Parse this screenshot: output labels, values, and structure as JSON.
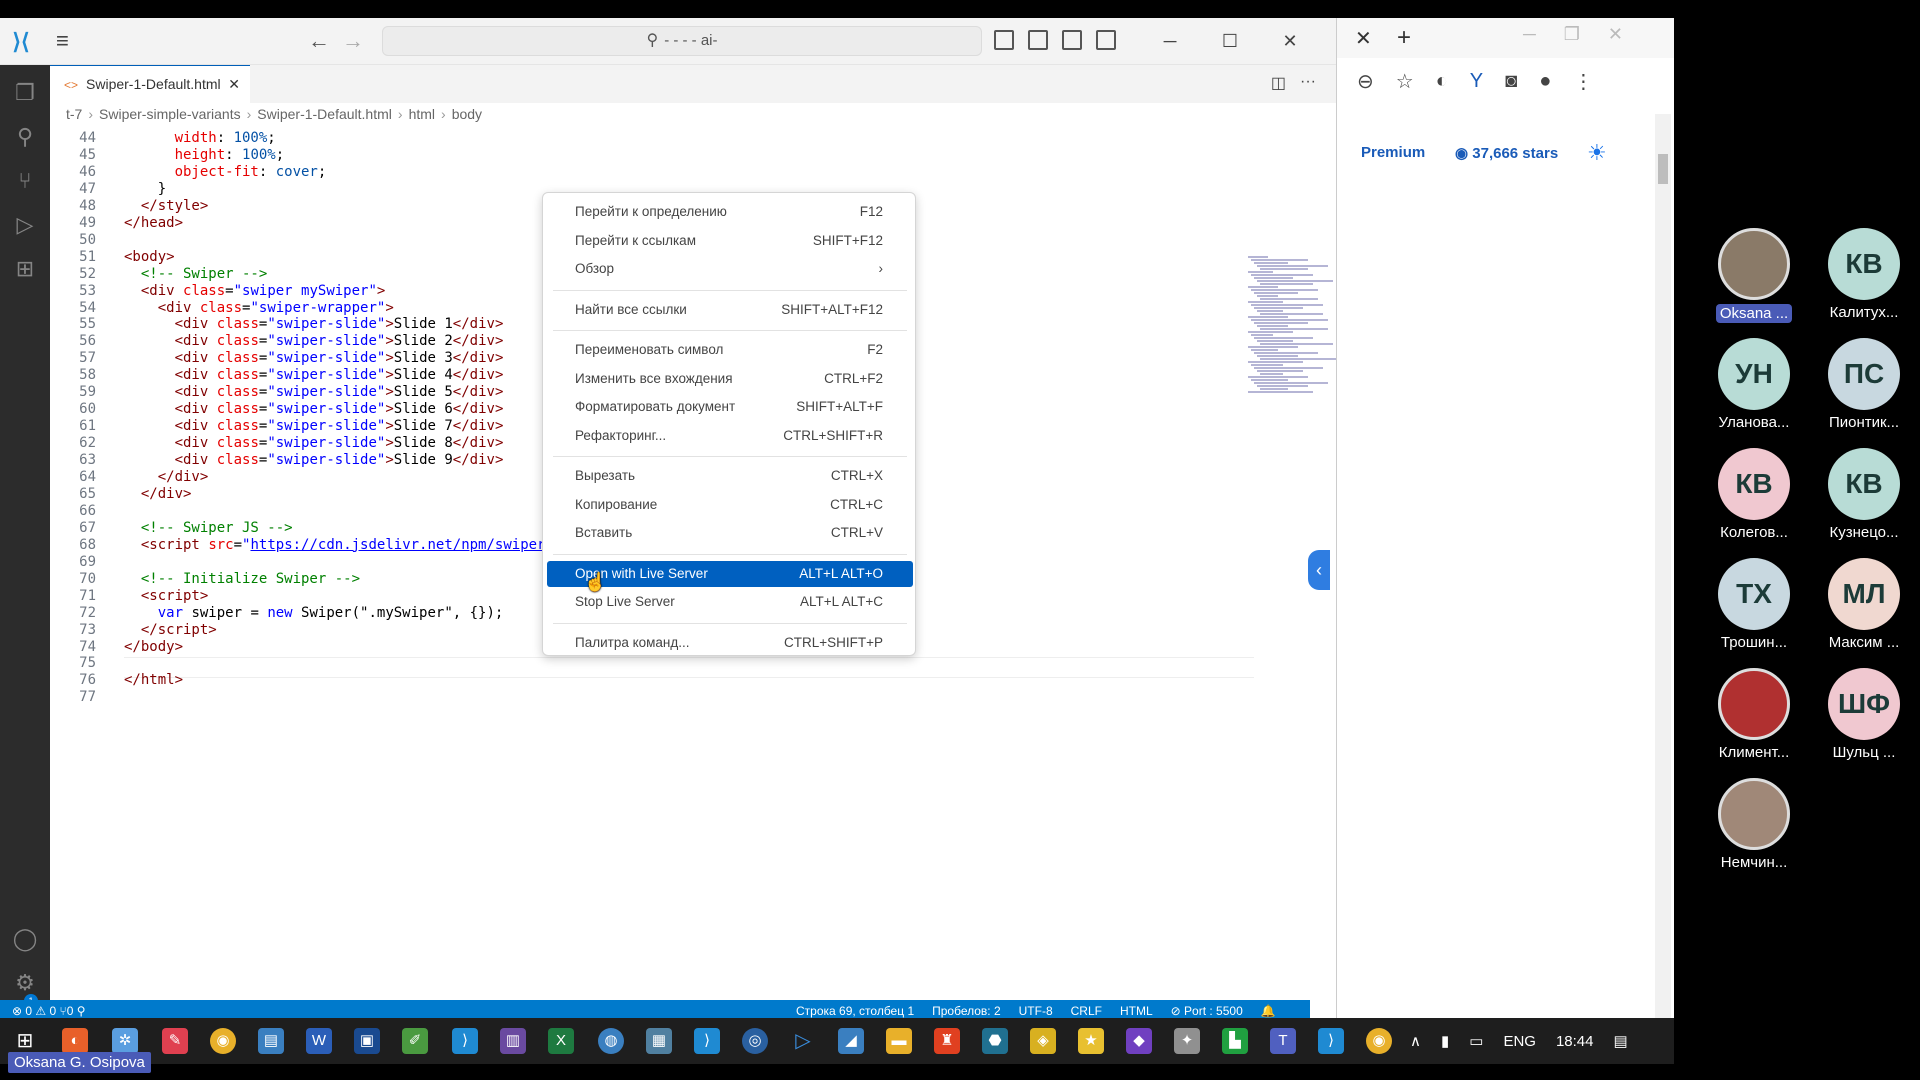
{
  "titlebar": {
    "search_text": "- - - - ai-",
    "back": "←",
    "forward": "→"
  },
  "tab": {
    "label": "Swiper-1-Default.html",
    "close": "✕"
  },
  "breadcrumb": [
    "t-7",
    "Swiper-simple-variants",
    "Swiper-1-Default.html",
    "html",
    "body"
  ],
  "code_lines": [
    {
      "n": "44",
      "html": "<span class='pr'>      width</span>: <span class='vl'>100%</span>;"
    },
    {
      "n": "45",
      "html": "<span class='pr'>      height</span>: <span class='vl'>100%</span>;"
    },
    {
      "n": "46",
      "html": "<span class='pr'>      object-fit</span>: <span class='vl'>cover</span>;"
    },
    {
      "n": "47",
      "html": "    }"
    },
    {
      "n": "48",
      "html": "  <span class='tag'>&lt;/style&gt;</span>"
    },
    {
      "n": "49",
      "html": "<span class='tag'>&lt;/head&gt;</span>"
    },
    {
      "n": "50",
      "html": ""
    },
    {
      "n": "51",
      "html": "<span class='tag'>&lt;body&gt;</span>"
    },
    {
      "n": "52",
      "html": "  <span class='cm'>&lt;!-- Swiper --&gt;</span>"
    },
    {
      "n": "53",
      "html": "  <span class='tag'>&lt;div</span> <span class='at'>class</span>=<span class='st'>\"swiper mySwiper\"</span><span class='tag'>&gt;</span>"
    },
    {
      "n": "54",
      "html": "    <span class='tag'>&lt;div</span> <span class='at'>class</span>=<span class='st'>\"swiper-wrapper\"</span><span class='tag'>&gt;</span>"
    },
    {
      "n": "55",
      "html": "      <span class='tag'>&lt;div</span> <span class='at'>class</span>=<span class='st'>\"swiper-slide\"</span><span class='tag'>&gt;</span>Slide 1<span class='tag'>&lt;/div&gt;</span>"
    },
    {
      "n": "56",
      "html": "      <span class='tag'>&lt;div</span> <span class='at'>class</span>=<span class='st'>\"swiper-slide\"</span><span class='tag'>&gt;</span>Slide 2<span class='tag'>&lt;/div&gt;</span>"
    },
    {
      "n": "57",
      "html": "      <span class='tag'>&lt;div</span> <span class='at'>class</span>=<span class='st'>\"swiper-slide\"</span><span class='tag'>&gt;</span>Slide 3<span class='tag'>&lt;/div&gt;</span>"
    },
    {
      "n": "58",
      "html": "      <span class='tag'>&lt;div</span> <span class='at'>class</span>=<span class='st'>\"swiper-slide\"</span><span class='tag'>&gt;</span>Slide 4<span class='tag'>&lt;/div&gt;</span>"
    },
    {
      "n": "59",
      "html": "      <span class='tag'>&lt;div</span> <span class='at'>class</span>=<span class='st'>\"swiper-slide\"</span><span class='tag'>&gt;</span>Slide 5<span class='tag'>&lt;/div&gt;</span>"
    },
    {
      "n": "60",
      "html": "      <span class='tag'>&lt;div</span> <span class='at'>class</span>=<span class='st'>\"swiper-slide\"</span><span class='tag'>&gt;</span>Slide 6<span class='tag'>&lt;/div&gt;</span>"
    },
    {
      "n": "61",
      "html": "      <span class='tag'>&lt;div</span> <span class='at'>class</span>=<span class='st'>\"swiper-slide\"</span><span class='tag'>&gt;</span>Slide 7<span class='tag'>&lt;/div&gt;</span>"
    },
    {
      "n": "62",
      "html": "      <span class='tag'>&lt;div</span> <span class='at'>class</span>=<span class='st'>\"swiper-slide\"</span><span class='tag'>&gt;</span>Slide 8<span class='tag'>&lt;/div&gt;</span>"
    },
    {
      "n": "63",
      "html": "      <span class='tag'>&lt;div</span> <span class='at'>class</span>=<span class='st'>\"swiper-slide\"</span><span class='tag'>&gt;</span>Slide 9<span class='tag'>&lt;/div&gt;</span>"
    },
    {
      "n": "64",
      "html": "    <span class='tag'>&lt;/div&gt;</span>"
    },
    {
      "n": "65",
      "html": "  <span class='tag'>&lt;/div&gt;</span>"
    },
    {
      "n": "66",
      "html": ""
    },
    {
      "n": "67",
      "html": "  <span class='cm'>&lt;!-- Swiper JS --&gt;</span>"
    },
    {
      "n": "68",
      "html": "  <span class='tag'>&lt;script</span> <span class='at'>src</span>=<span class='st'>\"<span class='lk'>https://cdn.jsdelivr.net/npm/swiper</span></span>"
    },
    {
      "n": "69",
      "html": ""
    },
    {
      "n": "70",
      "html": "  <span class='cm'>&lt;!-- Initialize Swiper --&gt;</span>"
    },
    {
      "n": "71",
      "html": "  <span class='tag'>&lt;script&gt;</span>"
    },
    {
      "n": "72",
      "html": "    <span class='kw'>var</span> swiper = <span class='kw'>new</span> Swiper(\".mySwiper\", {});"
    },
    {
      "n": "73",
      "html": "  <span class='tag'>&lt;/script&gt;</span>"
    },
    {
      "n": "74",
      "html": "<span class='tag'>&lt;/body&gt;</span>"
    },
    {
      "n": "75",
      "html": ""
    },
    {
      "n": "76",
      "html": "<span class='tag'>&lt;/html&gt;</span>"
    },
    {
      "n": "77",
      "html": ""
    }
  ],
  "context_menu": {
    "groups": [
      [
        {
          "label": "Перейти к определению",
          "kb": "F12"
        },
        {
          "label": "Перейти к ссылкам",
          "kb": "SHIFT+F12"
        },
        {
          "label": "Обзор",
          "kb": "›"
        }
      ],
      [
        {
          "label": "Найти все ссылки",
          "kb": "SHIFT+ALT+F12"
        }
      ],
      [
        {
          "label": "Переименовать символ",
          "kb": "F2"
        },
        {
          "label": "Изменить все вхождения",
          "kb": "CTRL+F2"
        },
        {
          "label": "Форматировать документ",
          "kb": "SHIFT+ALT+F"
        },
        {
          "label": "Рефакторинг...",
          "kb": "CTRL+SHIFT+R"
        }
      ],
      [
        {
          "label": "Вырезать",
          "kb": "CTRL+X"
        },
        {
          "label": "Копирование",
          "kb": "CTRL+C"
        },
        {
          "label": "Вставить",
          "kb": "CTRL+V"
        }
      ],
      [
        {
          "label": "Open with Live Server",
          "kb": "ALT+L ALT+O",
          "active": true
        },
        {
          "label": "Stop Live Server",
          "kb": "ALT+L ALT+C"
        }
      ],
      [
        {
          "label": "Палитра команд...",
          "kb": "CTRL+SHIFT+P"
        }
      ]
    ]
  },
  "statusbar": {
    "left": "⊗ 0 ⚠ 0   ⑂0   ⚲",
    "items": [
      "Строка 69, столбец 1",
      "Пробелов: 2",
      "UTF-8",
      "CRLF",
      "HTML",
      "⊘ Port : 5500",
      "🔔"
    ]
  },
  "browser": {
    "premium": "Premium",
    "stars": "37,666 stars"
  },
  "participants": [
    {
      "initials": "",
      "name": "Oksana ...",
      "photo": true,
      "selected": true,
      "color": "#8a7a68"
    },
    {
      "initials": "КВ",
      "name": "Калитух...",
      "color": "#b8dcd6"
    },
    {
      "initials": "УН",
      "name": "Уланова...",
      "color": "#b8dcd6"
    },
    {
      "initials": "ПС",
      "name": "Пионтик...",
      "color": "#c8d8e0"
    },
    {
      "initials": "КВ",
      "name": "Колегов...",
      "color": "#f0c8d0"
    },
    {
      "initials": "КВ",
      "name": "Кузнецо...",
      "color": "#b8dcd6"
    },
    {
      "initials": "ТХ",
      "name": "Трошин...",
      "color": "#c8d8e0"
    },
    {
      "initials": "МЛ",
      "name": "Максим ...",
      "color": "#f0d8d0"
    },
    {
      "initials": "",
      "name": "Климент...",
      "photo": true,
      "color": "#b03030"
    },
    {
      "initials": "ШФ",
      "name": "Шульц ...",
      "color": "#f0c8d0"
    },
    {
      "initials": "",
      "name": "Немчин...",
      "photo": true,
      "color": "#a08878"
    }
  ],
  "taskbar": {
    "lang": "ENG",
    "time": "18:44"
  },
  "presenter": "Oksana G. Osipova"
}
